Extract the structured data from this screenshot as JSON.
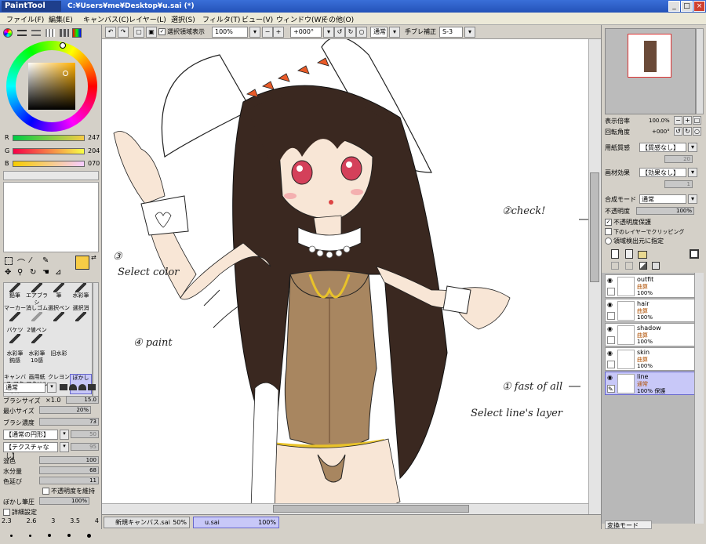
{
  "window": {
    "logo": "PaintTool SAI",
    "path": "C:¥Users¥me¥Desktop¥u.sai (*)",
    "min": "_",
    "max": "□",
    "close": "×"
  },
  "menu": [
    "ファイル(F)",
    "編集(E)",
    "キャンバス(C)",
    "レイヤー(L)",
    "選択(S)",
    "フィルタ(T)",
    "ビュー(V)",
    "ウィンドウ(W)",
    "その他(O)"
  ],
  "toolbar": {
    "selection_label": "選択領域表示",
    "zoom": "100%",
    "rotation": "+000°",
    "blend": "通常",
    "stabilizer_label": "手ブレ補正",
    "stabilizer": "S-3"
  },
  "color": {
    "r_label": "R",
    "r": "247",
    "g_label": "G",
    "g": "204",
    "b_label": "B",
    "b": "070",
    "current": "#f7cc46"
  },
  "tools": [
    [
      "鉛筆",
      "エアブラシ",
      "筆",
      "水彩筆"
    ],
    [
      "マーカー",
      "消しゴム",
      "選択ペン",
      "選択消"
    ],
    [
      "バケツ",
      "2値ペン",
      "",
      ""
    ],
    [
      "水彩筆 鈍感",
      "水彩筆 10感",
      "旧水彩",
      ""
    ],
    [
      "キャンバス アクリル",
      "画用紙 アクリル",
      "クレヨン",
      "ぼかし"
    ]
  ],
  "brush": {
    "mode": "通常",
    "size_label": "ブラシサイズ",
    "size_mult": "×1.0",
    "size": "15.0",
    "min_label": "最小サイズ",
    "min": "20%",
    "density_label": "ブラシ濃度",
    "density": "73",
    "shape": "【通常の円形】",
    "shape_val": "50",
    "texture": "【テクスチャなし】",
    "texture_val": "95",
    "mix_label": "混色",
    "mix": "100",
    "water_label": "水分量",
    "water": "68",
    "extend_label": "色延び",
    "extend": "11",
    "keep_opacity": "不透明度を維持",
    "blur_label": "ぼかし筆圧",
    "blur": "100%",
    "detail": "詳細設定",
    "sizes": [
      "2.3",
      "2.6",
      "3",
      "3.5",
      "4"
    ]
  },
  "navigator": {
    "zoom_label": "表示倍率",
    "zoom": "100.0%",
    "rot_label": "回転角度",
    "rot": "+000°"
  },
  "paper": {
    "texture_label": "用紙質感",
    "texture": "【質感なし】",
    "texture_val": "20",
    "effect_label": "画材効果",
    "effect": "【効果なし】",
    "effect_val": "1",
    "blend_label": "合成モード",
    "blend": "通常",
    "opacity_label": "不透明度",
    "opacity": "100%",
    "protect": "不透明度保護",
    "clip": "下のレイヤーでクリッピング",
    "source": "領域検出元に指定"
  },
  "layers": [
    {
      "name": "outfit",
      "mode": "曲算",
      "opacity": "100%",
      "selected": false
    },
    {
      "name": "hair",
      "mode": "曲算",
      "opacity": "100%",
      "selected": false
    },
    {
      "name": "shadow",
      "mode": "曲算",
      "opacity": "100%",
      "selected": false
    },
    {
      "name": "skin",
      "mode": "曲算",
      "opacity": "100%",
      "selected": false
    },
    {
      "name": "line",
      "mode": "通常",
      "opacity": "100% 保護",
      "selected": true
    }
  ],
  "canvas_tabs": [
    {
      "name": "新規キャンバス.sai",
      "zoom": "50%"
    },
    {
      "name": "u.sai",
      "zoom": "100%"
    }
  ],
  "status": "変換モード",
  "annotations": {
    "a1": "① fast of all",
    "a1b": "Select line's layer",
    "a2": "②check!",
    "a3": "③",
    "a3b": "Select color",
    "a4": "④ paint"
  }
}
